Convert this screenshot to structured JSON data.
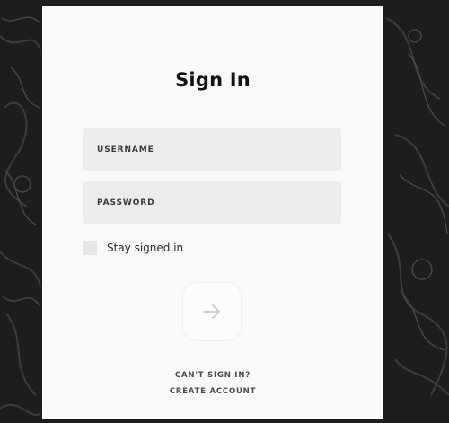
{
  "signin": {
    "title": "Sign In",
    "username_placeholder": "USERNAME",
    "password_placeholder": "PASSWORD",
    "stay_signed_in_label": "Stay signed in",
    "stay_signed_in_checked": false,
    "submit_icon": "arrow-right-icon",
    "cant_sign_in_link": "CAN'T SIGN IN?",
    "create_account_link": "CREATE ACCOUNT"
  },
  "colors": {
    "background": "#1d1d1d",
    "panel": "#f9f9f9",
    "field": "#ececec",
    "text": "#111111"
  }
}
